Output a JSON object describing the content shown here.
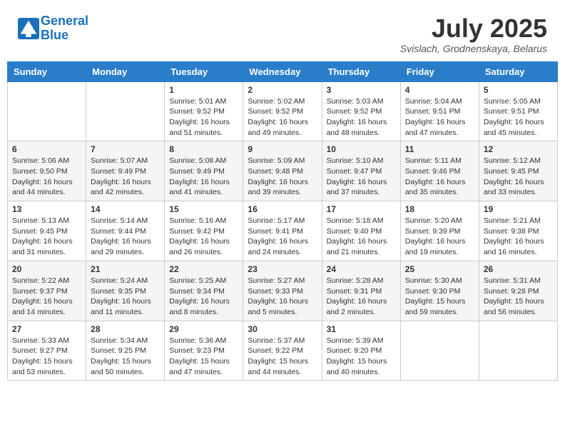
{
  "header": {
    "logo_line1": "General",
    "logo_line2": "Blue",
    "month": "July 2025",
    "location": "Svislach, Grodnenskaya, Belarus"
  },
  "weekdays": [
    "Sunday",
    "Monday",
    "Tuesday",
    "Wednesday",
    "Thursday",
    "Friday",
    "Saturday"
  ],
  "weeks": [
    [
      {
        "day": "",
        "sunrise": "",
        "sunset": "",
        "daylight": ""
      },
      {
        "day": "",
        "sunrise": "",
        "sunset": "",
        "daylight": ""
      },
      {
        "day": "1",
        "sunrise": "Sunrise: 5:01 AM",
        "sunset": "Sunset: 9:52 PM",
        "daylight": "Daylight: 16 hours and 51 minutes."
      },
      {
        "day": "2",
        "sunrise": "Sunrise: 5:02 AM",
        "sunset": "Sunset: 9:52 PM",
        "daylight": "Daylight: 16 hours and 49 minutes."
      },
      {
        "day": "3",
        "sunrise": "Sunrise: 5:03 AM",
        "sunset": "Sunset: 9:52 PM",
        "daylight": "Daylight: 16 hours and 48 minutes."
      },
      {
        "day": "4",
        "sunrise": "Sunrise: 5:04 AM",
        "sunset": "Sunset: 9:51 PM",
        "daylight": "Daylight: 16 hours and 47 minutes."
      },
      {
        "day": "5",
        "sunrise": "Sunrise: 5:05 AM",
        "sunset": "Sunset: 9:51 PM",
        "daylight": "Daylight: 16 hours and 45 minutes."
      }
    ],
    [
      {
        "day": "6",
        "sunrise": "Sunrise: 5:06 AM",
        "sunset": "Sunset: 9:50 PM",
        "daylight": "Daylight: 16 hours and 44 minutes."
      },
      {
        "day": "7",
        "sunrise": "Sunrise: 5:07 AM",
        "sunset": "Sunset: 9:49 PM",
        "daylight": "Daylight: 16 hours and 42 minutes."
      },
      {
        "day": "8",
        "sunrise": "Sunrise: 5:08 AM",
        "sunset": "Sunset: 9:49 PM",
        "daylight": "Daylight: 16 hours and 41 minutes."
      },
      {
        "day": "9",
        "sunrise": "Sunrise: 5:09 AM",
        "sunset": "Sunset: 9:48 PM",
        "daylight": "Daylight: 16 hours and 39 minutes."
      },
      {
        "day": "10",
        "sunrise": "Sunrise: 5:10 AM",
        "sunset": "Sunset: 9:47 PM",
        "daylight": "Daylight: 16 hours and 37 minutes."
      },
      {
        "day": "11",
        "sunrise": "Sunrise: 5:11 AM",
        "sunset": "Sunset: 9:46 PM",
        "daylight": "Daylight: 16 hours and 35 minutes."
      },
      {
        "day": "12",
        "sunrise": "Sunrise: 5:12 AM",
        "sunset": "Sunset: 9:45 PM",
        "daylight": "Daylight: 16 hours and 33 minutes."
      }
    ],
    [
      {
        "day": "13",
        "sunrise": "Sunrise: 5:13 AM",
        "sunset": "Sunset: 9:45 PM",
        "daylight": "Daylight: 16 hours and 31 minutes."
      },
      {
        "day": "14",
        "sunrise": "Sunrise: 5:14 AM",
        "sunset": "Sunset: 9:44 PM",
        "daylight": "Daylight: 16 hours and 29 minutes."
      },
      {
        "day": "15",
        "sunrise": "Sunrise: 5:16 AM",
        "sunset": "Sunset: 9:42 PM",
        "daylight": "Daylight: 16 hours and 26 minutes."
      },
      {
        "day": "16",
        "sunrise": "Sunrise: 5:17 AM",
        "sunset": "Sunset: 9:41 PM",
        "daylight": "Daylight: 16 hours and 24 minutes."
      },
      {
        "day": "17",
        "sunrise": "Sunrise: 5:18 AM",
        "sunset": "Sunset: 9:40 PM",
        "daylight": "Daylight: 16 hours and 21 minutes."
      },
      {
        "day": "18",
        "sunrise": "Sunrise: 5:20 AM",
        "sunset": "Sunset: 9:39 PM",
        "daylight": "Daylight: 16 hours and 19 minutes."
      },
      {
        "day": "19",
        "sunrise": "Sunrise: 5:21 AM",
        "sunset": "Sunset: 9:38 PM",
        "daylight": "Daylight: 16 hours and 16 minutes."
      }
    ],
    [
      {
        "day": "20",
        "sunrise": "Sunrise: 5:22 AM",
        "sunset": "Sunset: 9:37 PM",
        "daylight": "Daylight: 16 hours and 14 minutes."
      },
      {
        "day": "21",
        "sunrise": "Sunrise: 5:24 AM",
        "sunset": "Sunset: 9:35 PM",
        "daylight": "Daylight: 16 hours and 11 minutes."
      },
      {
        "day": "22",
        "sunrise": "Sunrise: 5:25 AM",
        "sunset": "Sunset: 9:34 PM",
        "daylight": "Daylight: 16 hours and 8 minutes."
      },
      {
        "day": "23",
        "sunrise": "Sunrise: 5:27 AM",
        "sunset": "Sunset: 9:33 PM",
        "daylight": "Daylight: 16 hours and 5 minutes."
      },
      {
        "day": "24",
        "sunrise": "Sunrise: 5:28 AM",
        "sunset": "Sunset: 9:31 PM",
        "daylight": "Daylight: 16 hours and 2 minutes."
      },
      {
        "day": "25",
        "sunrise": "Sunrise: 5:30 AM",
        "sunset": "Sunset: 9:30 PM",
        "daylight": "Daylight: 15 hours and 59 minutes."
      },
      {
        "day": "26",
        "sunrise": "Sunrise: 5:31 AM",
        "sunset": "Sunset: 9:28 PM",
        "daylight": "Daylight: 15 hours and 56 minutes."
      }
    ],
    [
      {
        "day": "27",
        "sunrise": "Sunrise: 5:33 AM",
        "sunset": "Sunset: 9:27 PM",
        "daylight": "Daylight: 15 hours and 53 minutes."
      },
      {
        "day": "28",
        "sunrise": "Sunrise: 5:34 AM",
        "sunset": "Sunset: 9:25 PM",
        "daylight": "Daylight: 15 hours and 50 minutes."
      },
      {
        "day": "29",
        "sunrise": "Sunrise: 5:36 AM",
        "sunset": "Sunset: 9:23 PM",
        "daylight": "Daylight: 15 hours and 47 minutes."
      },
      {
        "day": "30",
        "sunrise": "Sunrise: 5:37 AM",
        "sunset": "Sunset: 9:22 PM",
        "daylight": "Daylight: 15 hours and 44 minutes."
      },
      {
        "day": "31",
        "sunrise": "Sunrise: 5:39 AM",
        "sunset": "Sunset: 9:20 PM",
        "daylight": "Daylight: 15 hours and 40 minutes."
      },
      {
        "day": "",
        "sunrise": "",
        "sunset": "",
        "daylight": ""
      },
      {
        "day": "",
        "sunrise": "",
        "sunset": "",
        "daylight": ""
      }
    ]
  ]
}
